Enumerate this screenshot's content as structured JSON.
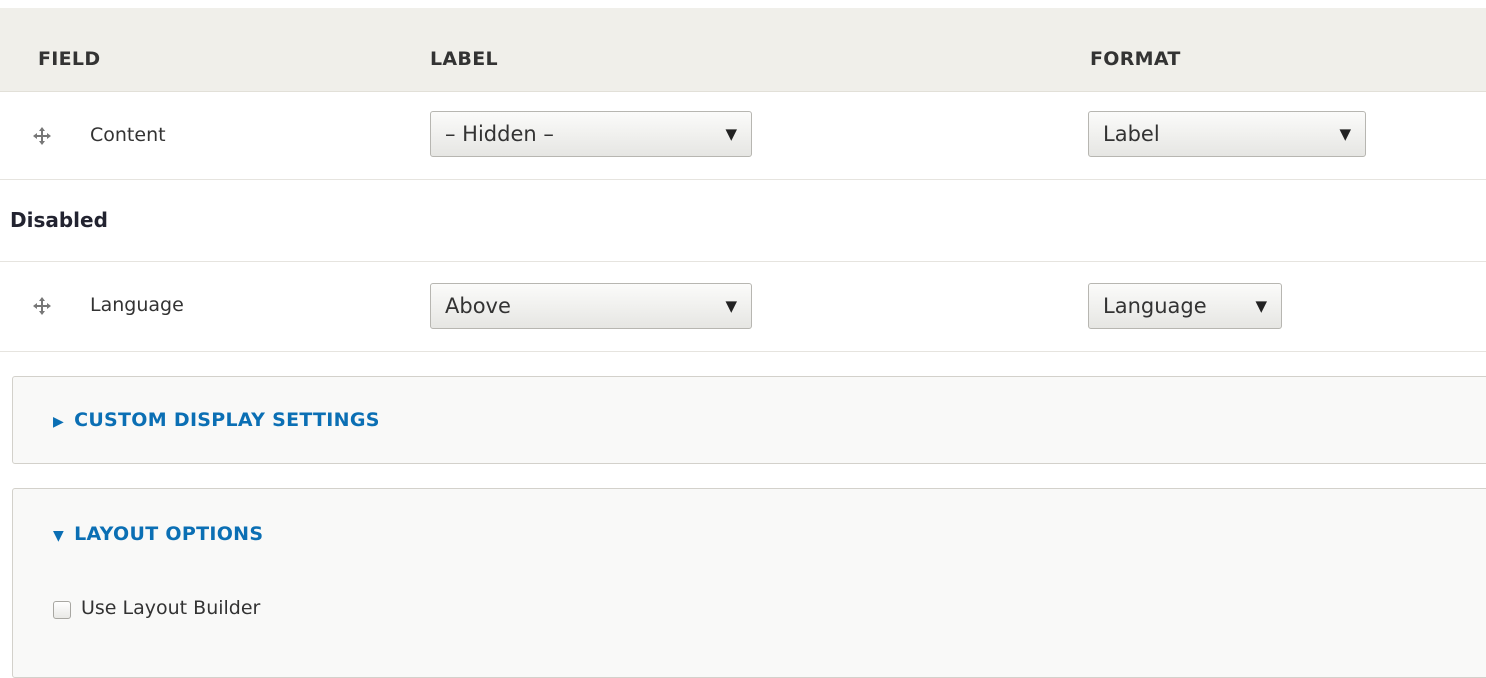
{
  "table": {
    "headers": {
      "field": "FIELD",
      "label": "LABEL",
      "format": "FORMAT"
    },
    "rows": [
      {
        "field": "Content",
        "label_select": "– Hidden –",
        "format_select": "Label"
      }
    ],
    "disabled_region": {
      "title": "Disabled",
      "rows": [
        {
          "field": "Language",
          "label_select": "Above",
          "format_select": "Language"
        }
      ]
    }
  },
  "custom_display_settings": {
    "title": "CUSTOM DISPLAY SETTINGS",
    "expanded": false
  },
  "layout_options": {
    "title": "LAYOUT OPTIONS",
    "expanded": true,
    "use_layout_builder": {
      "label": "Use Layout Builder",
      "checked": false
    }
  },
  "colors": {
    "header_bg": "#f0efea",
    "link_blue": "#0b6fb4"
  },
  "icons": {
    "drag_handle": "move-cross-icon",
    "select_arrow": "triangle-down-icon",
    "collapsed": "triangle-right-icon",
    "expanded": "triangle-down-icon"
  }
}
